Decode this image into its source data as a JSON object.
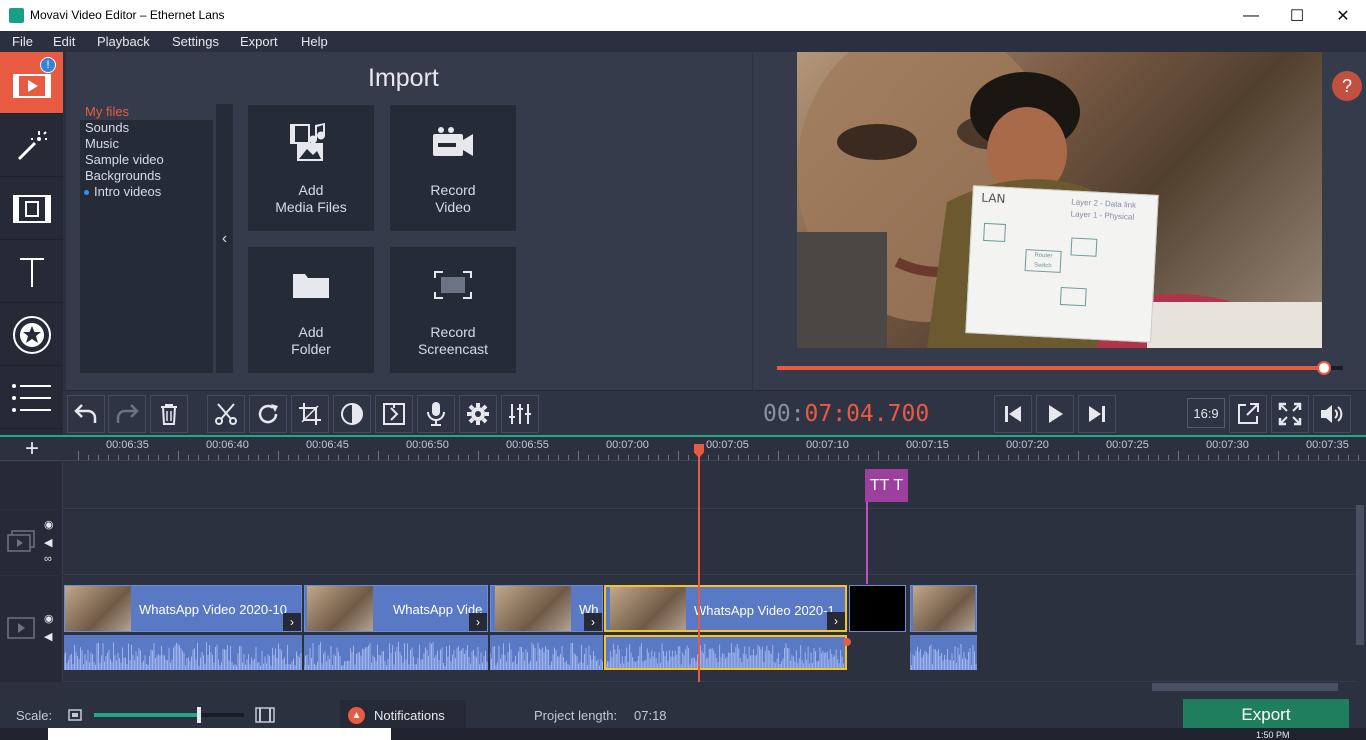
{
  "window": {
    "title": "Movavi Video Editor – Ethernet Lans",
    "minimize": "—",
    "maximize": "☐",
    "close": "✕"
  },
  "menu": [
    "File",
    "Edit",
    "Playback",
    "Settings",
    "Export",
    "Help"
  ],
  "sidebar": {
    "badge": "!",
    "items": [
      "import-icon",
      "magic-wand-icon",
      "transitions-icon",
      "titles-icon",
      "stickers-icon",
      "more-icon"
    ]
  },
  "import": {
    "title": "Import",
    "categories": [
      "My files",
      "Sounds",
      "Music",
      "Sample video",
      "Backgrounds",
      "Intro videos"
    ],
    "selected_category": "My files",
    "dotted_category": "Intro videos",
    "collapse_glyph": "‹",
    "tiles": [
      {
        "line1": "Add",
        "line2": "Media Files"
      },
      {
        "line1": "Record",
        "line2": "Video"
      },
      {
        "line1": "Add",
        "line2": "Folder"
      },
      {
        "line1": "Record",
        "line2": "Screencast"
      }
    ]
  },
  "preview": {
    "help_label": "?",
    "progress": 0.967,
    "board_title": "LAN",
    "board_lines": [
      "Layer 2 - Data link",
      "Layer 1 - Physical",
      "Router",
      "Switch"
    ]
  },
  "playback": {
    "timecode_prefix": "00:",
    "timecode_value": "07:04.700",
    "aspect_ratio": "16:9"
  },
  "timeline": {
    "add_label": "+",
    "ruler_ticks": [
      "00:06:35",
      "00:06:40",
      "00:06:45",
      "00:06:50",
      "00:06:55",
      "00:07:00",
      "00:07:05",
      "00:07:10",
      "00:07:15",
      "00:07:20",
      "00:07:25",
      "00:07:30",
      "00:07:35"
    ],
    "title_clip_label": "TT T",
    "clips": [
      {
        "name": "WhatsApp Video 2020-10"
      },
      {
        "name": "WhatsApp Vide"
      },
      {
        "name": "Wh"
      },
      {
        "name": "WhatsApp Video 2020-1"
      },
      {
        "name": ""
      },
      {
        "name": ""
      }
    ]
  },
  "status": {
    "scale_label": "Scale:",
    "scale_value": 0.7,
    "notifications_label": "Notifications",
    "project_length_label": "Project length:",
    "project_length_value": "07:18",
    "export_label": "Export",
    "clock": "1:50 PM"
  },
  "colors": {
    "accent": "#e95a43",
    "export_green": "#1e7e5e",
    "clip_blue": "#5a79c4",
    "title_purple": "#9c3f9f"
  }
}
